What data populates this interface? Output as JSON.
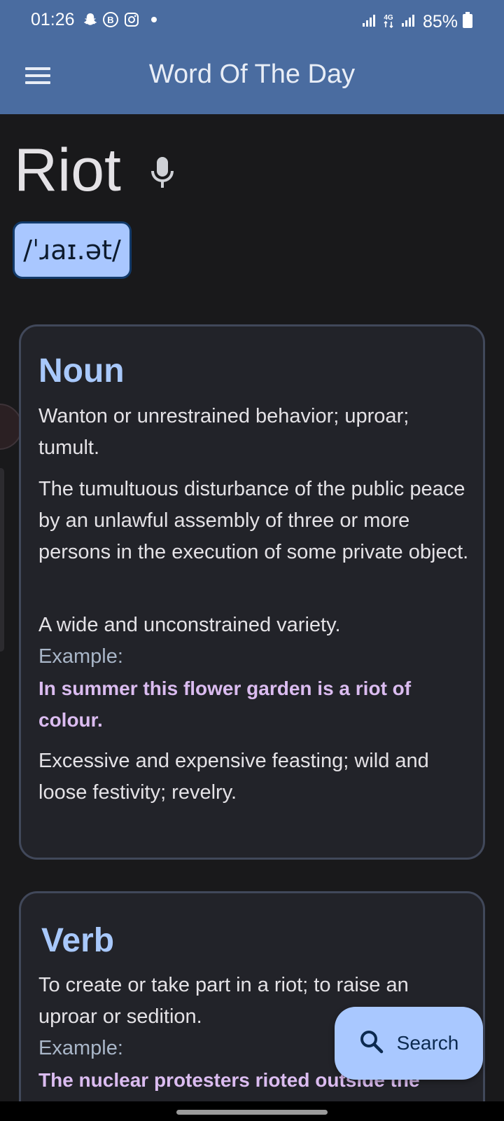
{
  "status_bar": {
    "time": "01:26",
    "left_icons": [
      "snapchat-icon",
      "b-badge-icon",
      "instagram-icon",
      "dot-icon"
    ],
    "right_icons": [
      "signal-icon",
      "4g-icon",
      "signal-icon",
      "battery-icon"
    ],
    "battery": "85%"
  },
  "app_bar": {
    "title": "Word Of The Day",
    "menu_icon": "menu-icon"
  },
  "word": {
    "text": "Riot",
    "mic_icon": "mic-icon",
    "phonetic": "/ˈɹaɪ.ət/"
  },
  "cards": [
    {
      "part_of_speech": "Noun",
      "definitions": [
        "Wanton or unrestrained behavior; uproar; tumult.",
        "The tumultuous disturbance of the public peace by an unlawful assembly of three or more persons in the execution of some private object.",
        "A wide and unconstrained variety.",
        "Excessive and expensive feasting; wild and loose festivity; revelry."
      ],
      "example_label": "Example:",
      "example": "In summer this flower garden is a riot of colour."
    },
    {
      "part_of_speech": "Verb",
      "definitions": [
        "To create or take part in a riot; to raise an uproar or sedition."
      ],
      "example_label": "Example:",
      "example": "The nuclear protesters rioted outside the"
    }
  ],
  "fab": {
    "icon": "search-icon",
    "label": "Search"
  },
  "colors": {
    "app_bar": "#4a6ca0",
    "background": "#19191b",
    "card": "#222329",
    "accent": "#a8c8fb",
    "example": "#dbbcf0"
  }
}
